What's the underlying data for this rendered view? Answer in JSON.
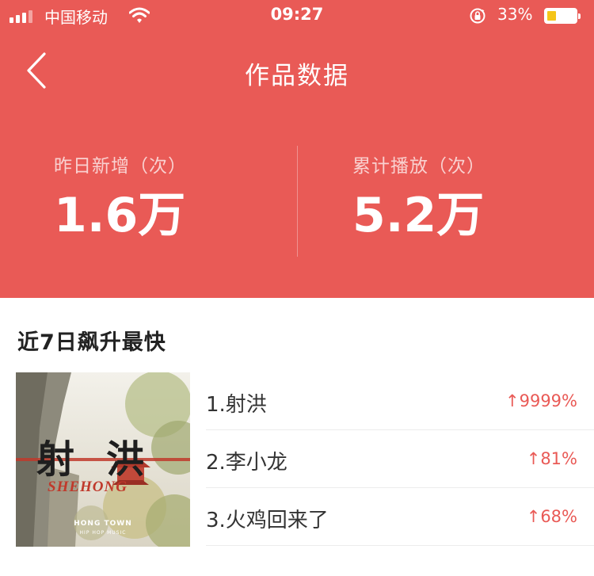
{
  "status_bar": {
    "carrier": "中国移动",
    "time": "09:27",
    "battery_percent": "33%",
    "battery_level": 0.33,
    "icons": [
      "signal-icon",
      "wifi-icon",
      "orientation-lock-icon",
      "battery-icon"
    ]
  },
  "nav": {
    "back_icon": "chevron-left-icon",
    "title": "作品数据"
  },
  "stats": {
    "yesterday_label": "昨日新增（次）",
    "yesterday_value": "1.6万",
    "total_label": "累计播放（次）",
    "total_value": "5.2万"
  },
  "trending": {
    "title": "近7日飙升最快",
    "cover": {
      "title_chars": "射洪",
      "title_latin": "SHEHONG",
      "subtitle": "HONG TOWN",
      "caption": "HIP HOP MUSIC"
    },
    "items": [
      {
        "name": "1.射洪",
        "change": "↑9999%"
      },
      {
        "name": "2.李小龙",
        "change": "↑81%"
      },
      {
        "name": "3.火鸡回来了",
        "change": "↑68%"
      }
    ]
  },
  "colors": {
    "header_bg": "#e95a56",
    "accent": "#e95a56",
    "text_dark": "#222222",
    "battery_fill": "#f5c518"
  }
}
